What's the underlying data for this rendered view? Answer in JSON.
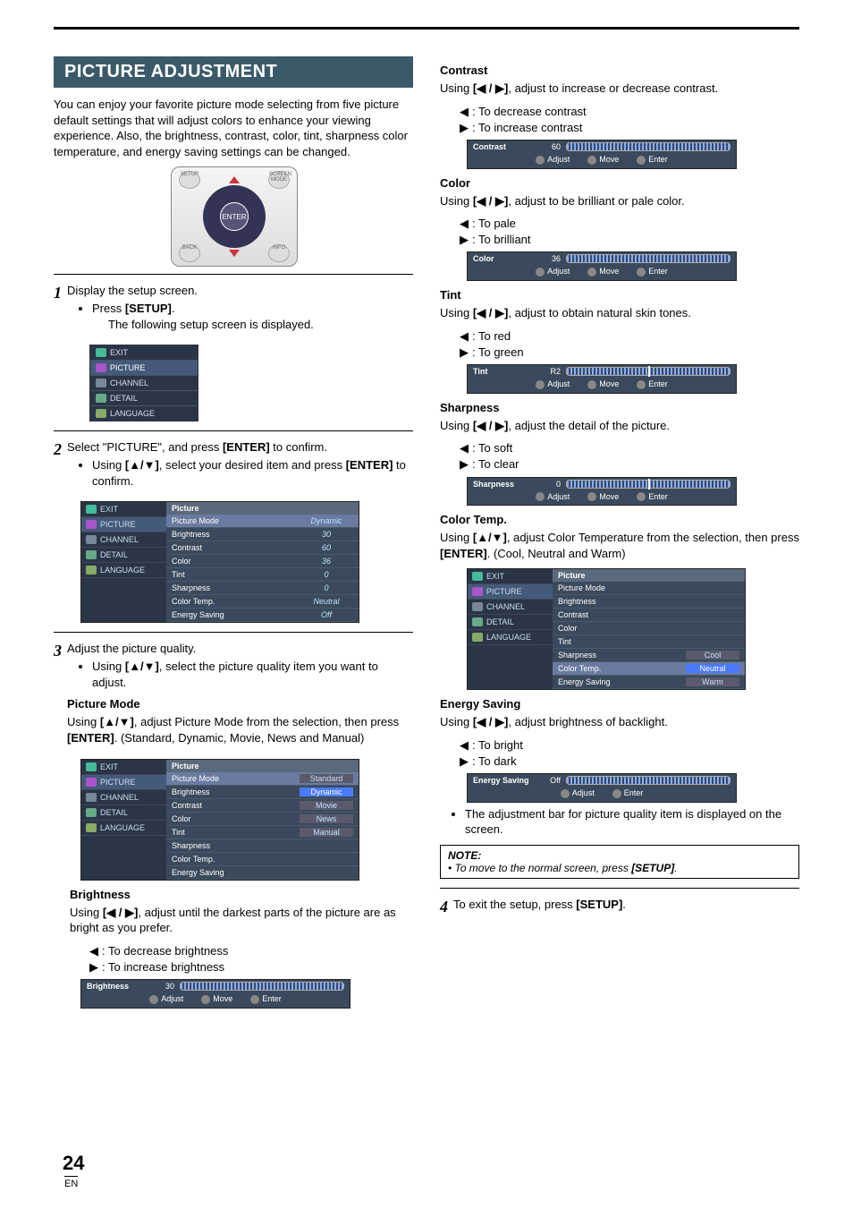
{
  "page": {
    "number": "24",
    "lang": "EN"
  },
  "header": {
    "title": "PICTURE ADJUSTMENT"
  },
  "intro": "You can enjoy your favorite picture mode selecting from five picture default settings that will adjust colors to enhance your viewing experience. Also, the brightness, contrast, color, tint, sharpness color temperature, and energy saving settings can be changed.",
  "remote": {
    "enter": "ENTER",
    "tl": "SETUP",
    "tr": "SCREEN MODE",
    "bl": "BACK",
    "br": "INFO"
  },
  "steps": {
    "s1": {
      "text": "Display the setup screen.",
      "b1a": "Press ",
      "b1b": "[SETUP]",
      "b1c": ".",
      "sub": "The following setup screen is displayed."
    },
    "s2": {
      "text_a": "Select \"PICTURE\", and press ",
      "text_b": "[ENTER]",
      "text_c": " to confirm.",
      "b1a": "Using ",
      "b1b": "[▲/▼]",
      "b1c": ", select your desired item and press ",
      "b1d": "[ENTER]",
      "b1e": " to confirm."
    },
    "s3": {
      "text": "Adjust the picture quality.",
      "b1a": "Using ",
      "b1b": "[▲/▼]",
      "b1c": ", select the picture quality item you want to adjust."
    },
    "s4": {
      "text_a": "To exit the setup, press ",
      "text_b": "[SETUP]",
      "text_c": "."
    }
  },
  "nav_items": {
    "exit": "EXIT",
    "picture": "PICTURE",
    "channel": "CHANNEL",
    "detail": "DETAIL",
    "language": "LANGUAGE"
  },
  "menu": {
    "hdr": "Picture",
    "rows": {
      "mode": {
        "k": "Picture Mode",
        "v": "Dynamic"
      },
      "bright": {
        "k": "Brightness",
        "v": "30"
      },
      "contrast": {
        "k": "Contrast",
        "v": "60"
      },
      "color": {
        "k": "Color",
        "v": "36"
      },
      "tint": {
        "k": "Tint",
        "v": "0"
      },
      "sharp": {
        "k": "Sharpness",
        "v": "0"
      },
      "ct": {
        "k": "Color Temp.",
        "v": "Neutral"
      },
      "es": {
        "k": "Energy Saving",
        "v": "Off"
      }
    },
    "mode_opts": {
      "standard": "Standard",
      "dynamic": "Dynamic",
      "movie": "Movie",
      "news": "News",
      "manual": "Manual"
    },
    "ct_opts": {
      "cool": "Cool",
      "neutral": "Neutral",
      "warm": "Warm"
    }
  },
  "items": {
    "picture_mode": {
      "title": "Picture Mode",
      "body_a": "Using ",
      "body_b": "[▲/▼]",
      "body_c": ", adjust Picture Mode from the selection, then press ",
      "body_d": "[ENTER]",
      "body_e": ". (Standard, Dynamic, Movie, News and Manual)"
    },
    "brightness": {
      "title": "Brightness",
      "body_a": "Using ",
      "body_b": "[◀ / ▶]",
      "body_c": ", adjust until the darkest parts of the picture are as bright as you prefer.",
      "left": ": To decrease brightness",
      "right": ": To increase brightness",
      "slider": {
        "label": "Brightness",
        "val": "30"
      }
    },
    "contrast": {
      "title": "Contrast",
      "body_a": "Using ",
      "body_b": "[◀ / ▶]",
      "body_c": ", adjust to increase or decrease contrast.",
      "left": ": To decrease contrast",
      "right": ": To increase contrast",
      "slider": {
        "label": "Contrast",
        "val": "60"
      }
    },
    "color": {
      "title": "Color",
      "body_a": "Using ",
      "body_b": "[◀ / ▶]",
      "body_c": ", adjust to be brilliant or pale color.",
      "left": ": To pale",
      "right": ": To brilliant",
      "slider": {
        "label": "Color",
        "val": "36"
      }
    },
    "tint": {
      "title": "Tint",
      "body_a": "Using ",
      "body_b": "[◀ / ▶]",
      "body_c": ", adjust to obtain natural skin tones.",
      "left": ": To red",
      "right": ": To green",
      "slider": {
        "label": "Tint",
        "val": "R2"
      }
    },
    "sharpness": {
      "title": "Sharpness",
      "body_a": "Using ",
      "body_b": "[◀ / ▶]",
      "body_c": ", adjust the detail of the picture.",
      "left": ": To soft",
      "right": ": To clear",
      "slider": {
        "label": "Sharpness",
        "val": "0"
      }
    },
    "colortemp": {
      "title": "Color Temp.",
      "body_a": "Using ",
      "body_b": "[▲/▼]",
      "body_c": ", adjust Color Temperature from the selection, then press ",
      "body_d": "[ENTER]",
      "body_e": ". (Cool, Neutral and Warm)"
    },
    "energy": {
      "title": "Energy Saving",
      "body_a": "Using ",
      "body_b": "[◀ / ▶]",
      "body_c": ", adjust brightness of backlight.",
      "left": ": To bright",
      "right": ": To dark",
      "slider": {
        "label": "Energy Saving",
        "val": "Off"
      }
    },
    "footer_bullet": "The adjustment bar for picture quality item is displayed on the screen."
  },
  "slider_btns": {
    "adjust": "Adjust",
    "move": "Move",
    "enter": "Enter"
  },
  "note": {
    "title": "NOTE:",
    "body_a": "• To move to the normal screen, press ",
    "body_b": "[SETUP]",
    "body_c": "."
  }
}
